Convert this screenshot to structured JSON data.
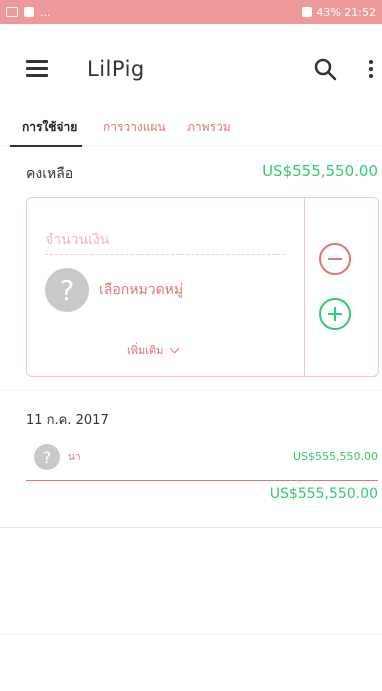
{
  "status_bar": {
    "left_text": "...",
    "right_text": "43% 21:52",
    "color": "#ef9a9a"
  },
  "app_bar": {
    "menu_icon": "menu-icon",
    "title": "LilPig",
    "search_icon": "search-icon",
    "more_icon": "more-vertical-icon"
  },
  "tabs": [
    {
      "label": "การใช้จ่าย",
      "active": true
    },
    {
      "label": "การวางแผน",
      "active": false
    },
    {
      "label": "ภาพรวม",
      "active": false
    }
  ],
  "balance": {
    "label": "คงเหลือ",
    "value": "US$555,550.00"
  },
  "entry": {
    "amount_placeholder": "จำนวนเงิน",
    "category_icon": "question-mark-icon",
    "category_label": "เลือกหมวดหมู่",
    "more_label": "เพิ่มเติม",
    "more_icon": "chevron-down-icon",
    "minus_icon": "minus-circle-icon",
    "plus_icon": "plus-circle-icon"
  },
  "transactions": [
    {
      "date": "11 ก.ค. 2017",
      "items": [
        {
          "icon": "question-mark-icon",
          "label": "นา",
          "amount": "US$555,550.00"
        }
      ],
      "total": "US$555,550.00"
    }
  ],
  "colors": {
    "accent": "#e57373",
    "positive": "#2ecc71",
    "border": "#f3c9c9"
  }
}
